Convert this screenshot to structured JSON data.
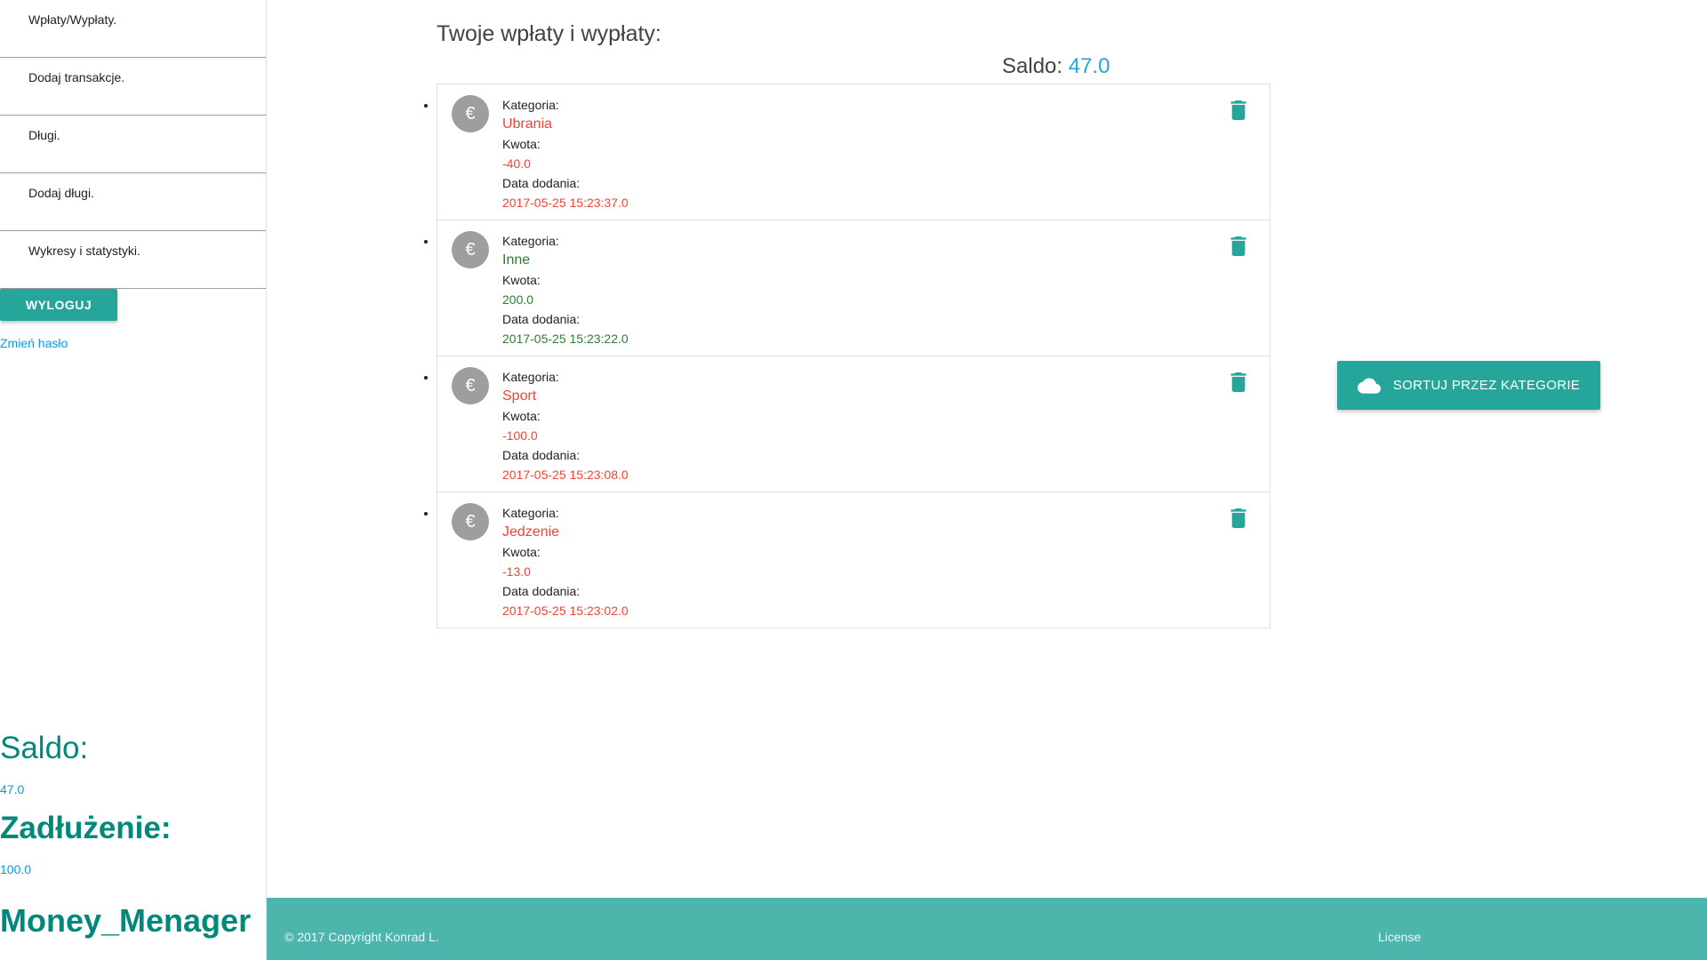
{
  "sidebar": {
    "items": [
      {
        "label": "Wpłaty/Wypłaty."
      },
      {
        "label": "Dodaj transakcje."
      },
      {
        "label": "Długi."
      },
      {
        "label": "Dodaj długi."
      },
      {
        "label": "Wykresy i statystyki."
      }
    ],
    "logout_label": "WYLOGUJ",
    "change_password_label": "Zmień hasło",
    "saldo_heading": "Saldo:",
    "saldo_value": "47.0",
    "debt_heading": "Zadłużenie:",
    "debt_value": "100.0",
    "brand": "Money_Menager"
  },
  "main": {
    "title": "Twoje wpłaty i wypłaty:",
    "saldo_label": "Saldo:",
    "saldo_value": "47.0",
    "labels": {
      "category": "Kategoria:",
      "amount": "Kwota:",
      "date": "Data dodania:"
    },
    "transactions": [
      {
        "category": "Ubrania",
        "amount": "-40.0",
        "date": "2017-05-25 15:23:37.0",
        "type": "neg"
      },
      {
        "category": "Inne",
        "amount": "200.0",
        "date": "2017-05-25 15:23:22.0",
        "type": "pos"
      },
      {
        "category": "Sport",
        "amount": "-100.0",
        "date": "2017-05-25 15:23:08.0",
        "type": "neg"
      },
      {
        "category": "Jedzenie",
        "amount": "-13.0",
        "date": "2017-05-25 15:23:02.0",
        "type": "neg"
      }
    ],
    "avatar_glyph": "€",
    "sort_button_label": "SORTUJ PRZEZ KATEGORIE"
  },
  "footer": {
    "copyright": "© 2017 Copyright Konrad L.",
    "license": "License"
  },
  "colors": {
    "accent": "#26a69a",
    "footer": "#4db6ac",
    "negative": "#f44336",
    "positive": "#2e7d32",
    "link": "#039be5",
    "heading_teal": "#00897b"
  },
  "icons": {
    "avatar": "euro-icon",
    "delete": "trash-icon",
    "sort": "cloud-icon"
  }
}
